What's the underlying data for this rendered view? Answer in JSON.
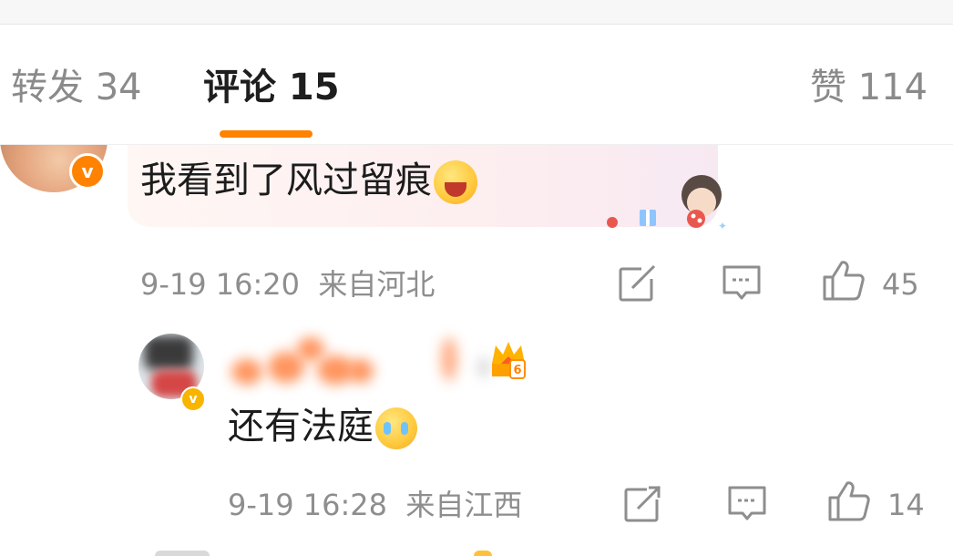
{
  "tabs": {
    "repost": "转发 34",
    "comment": "评论 15",
    "like": "赞 114"
  },
  "comments": [
    {
      "text": "我看到了风过留痕",
      "time": "9-19 16:20",
      "location": "来自河北",
      "likes": "45",
      "emoji": "laugh-emoji"
    },
    {
      "text": "还有法庭",
      "time": "9-19 16:28",
      "location": "来自江西",
      "likes": "14",
      "emoji": "crying-emoji",
      "badge_level": "6"
    }
  ],
  "colors": {
    "accent": "#ff8200",
    "muted": "#8e8e8e",
    "text": "#1c1c1c"
  }
}
